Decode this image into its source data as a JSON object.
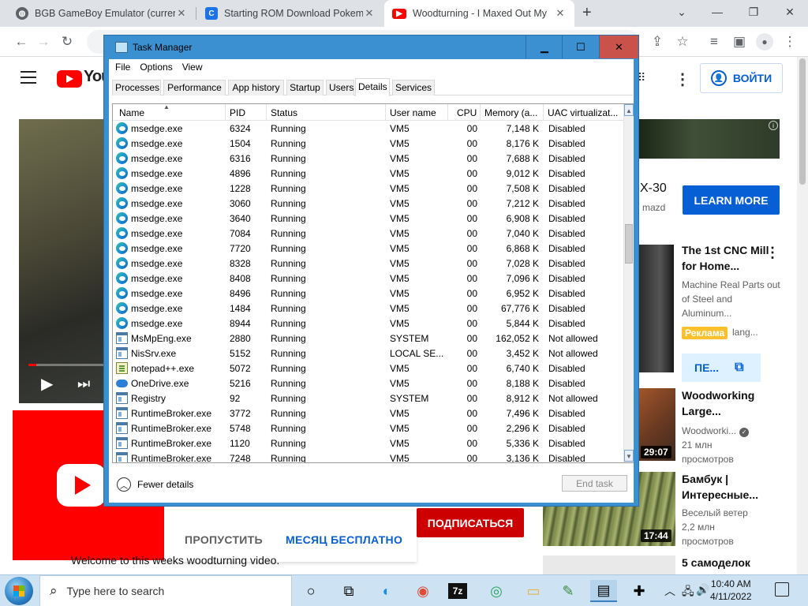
{
  "browser": {
    "tabs": [
      {
        "title": "BGB GameBoy Emulator (current",
        "favicon": "globe-icon",
        "active": false
      },
      {
        "title": "Starting ROM Download Pokemo",
        "favicon": "site-icon",
        "active": false
      },
      {
        "title": "Woodturning - I Maxed Out My",
        "favicon": "youtube-icon",
        "active": true
      }
    ],
    "tab_close": "✕",
    "new_tab": "+"
  },
  "youtube": {
    "logo_text": "YouT",
    "signin": "ВОЙТИ",
    "promo": {
      "skip": "ПРОПУСТИТЬ",
      "month_free": "МЕСЯЦ БЕСПЛАТНО",
      "subscribe": "ПОДПИСАТЬСЯ"
    },
    "welcome": "Welcome to this weeks woodturning video.",
    "ad": {
      "model": "X-30",
      "brand": "mazd",
      "learn_more": "LEARN MORE"
    },
    "recommendations": [
      {
        "title": "The 1st CNC Mill for Home...",
        "line1": "Machine Real Parts out of Steel and Aluminum...",
        "badge": "Реклама",
        "badge_extra": "lang...",
        "cta": "ПЕ..."
      },
      {
        "title": "Woodworking Large...",
        "channel": "Woodworki...",
        "views": "21 млн просмотров",
        "duration": "29:07"
      },
      {
        "title": "Бамбук | Интересные...",
        "channel": "Веселый ветер",
        "views": "2,2 млн просмотров",
        "duration": "17:44"
      },
      {
        "title": "5 самоделок"
      }
    ]
  },
  "task_manager": {
    "title": "Task Manager",
    "menu": [
      "File",
      "Options",
      "View"
    ],
    "tabs": [
      "Processes",
      "Performance",
      "App history",
      "Startup",
      "Users",
      "Details",
      "Services"
    ],
    "active_tab": "Details",
    "columns": [
      "Name",
      "PID",
      "Status",
      "User name",
      "CPU",
      "Memory (a...",
      "UAC virtualizat..."
    ],
    "rows": [
      {
        "icon": "edge",
        "name": "msedge.exe",
        "pid": "6324",
        "status": "Running",
        "user": "VM5",
        "cpu": "00",
        "mem": "7,148 K",
        "uac": "Disabled"
      },
      {
        "icon": "edge",
        "name": "msedge.exe",
        "pid": "1504",
        "status": "Running",
        "user": "VM5",
        "cpu": "00",
        "mem": "8,176 K",
        "uac": "Disabled"
      },
      {
        "icon": "edge",
        "name": "msedge.exe",
        "pid": "6316",
        "status": "Running",
        "user": "VM5",
        "cpu": "00",
        "mem": "7,688 K",
        "uac": "Disabled"
      },
      {
        "icon": "edge",
        "name": "msedge.exe",
        "pid": "4896",
        "status": "Running",
        "user": "VM5",
        "cpu": "00",
        "mem": "9,012 K",
        "uac": "Disabled"
      },
      {
        "icon": "edge",
        "name": "msedge.exe",
        "pid": "1228",
        "status": "Running",
        "user": "VM5",
        "cpu": "00",
        "mem": "7,508 K",
        "uac": "Disabled"
      },
      {
        "icon": "edge",
        "name": "msedge.exe",
        "pid": "3060",
        "status": "Running",
        "user": "VM5",
        "cpu": "00",
        "mem": "7,212 K",
        "uac": "Disabled"
      },
      {
        "icon": "edge",
        "name": "msedge.exe",
        "pid": "3640",
        "status": "Running",
        "user": "VM5",
        "cpu": "00",
        "mem": "6,908 K",
        "uac": "Disabled"
      },
      {
        "icon": "edge",
        "name": "msedge.exe",
        "pid": "7084",
        "status": "Running",
        "user": "VM5",
        "cpu": "00",
        "mem": "7,040 K",
        "uac": "Disabled"
      },
      {
        "icon": "edge",
        "name": "msedge.exe",
        "pid": "7720",
        "status": "Running",
        "user": "VM5",
        "cpu": "00",
        "mem": "6,868 K",
        "uac": "Disabled"
      },
      {
        "icon": "edge",
        "name": "msedge.exe",
        "pid": "8328",
        "status": "Running",
        "user": "VM5",
        "cpu": "00",
        "mem": "7,028 K",
        "uac": "Disabled"
      },
      {
        "icon": "edge",
        "name": "msedge.exe",
        "pid": "8408",
        "status": "Running",
        "user": "VM5",
        "cpu": "00",
        "mem": "7,096 K",
        "uac": "Disabled"
      },
      {
        "icon": "edge",
        "name": "msedge.exe",
        "pid": "8496",
        "status": "Running",
        "user": "VM5",
        "cpu": "00",
        "mem": "6,952 K",
        "uac": "Disabled"
      },
      {
        "icon": "edge",
        "name": "msedge.exe",
        "pid": "1484",
        "status": "Running",
        "user": "VM5",
        "cpu": "00",
        "mem": "67,776 K",
        "uac": "Disabled"
      },
      {
        "icon": "edge",
        "name": "msedge.exe",
        "pid": "8944",
        "status": "Running",
        "user": "VM5",
        "cpu": "00",
        "mem": "5,844 K",
        "uac": "Disabled"
      },
      {
        "icon": "win",
        "name": "MsMpEng.exe",
        "pid": "2880",
        "status": "Running",
        "user": "SYSTEM",
        "cpu": "00",
        "mem": "162,052 K",
        "uac": "Not allowed"
      },
      {
        "icon": "win",
        "name": "NisSrv.exe",
        "pid": "5152",
        "status": "Running",
        "user": "LOCAL SE...",
        "cpu": "00",
        "mem": "3,452 K",
        "uac": "Not allowed"
      },
      {
        "icon": "np",
        "name": "notepad++.exe",
        "pid": "5072",
        "status": "Running",
        "user": "VM5",
        "cpu": "00",
        "mem": "6,740 K",
        "uac": "Disabled"
      },
      {
        "icon": "cloud",
        "name": "OneDrive.exe",
        "pid": "5216",
        "status": "Running",
        "user": "VM5",
        "cpu": "00",
        "mem": "8,188 K",
        "uac": "Disabled"
      },
      {
        "icon": "win",
        "name": "Registry",
        "pid": "92",
        "status": "Running",
        "user": "SYSTEM",
        "cpu": "00",
        "mem": "8,912 K",
        "uac": "Not allowed"
      },
      {
        "icon": "win",
        "name": "RuntimeBroker.exe",
        "pid": "3772",
        "status": "Running",
        "user": "VM5",
        "cpu": "00",
        "mem": "7,496 K",
        "uac": "Disabled"
      },
      {
        "icon": "win",
        "name": "RuntimeBroker.exe",
        "pid": "5748",
        "status": "Running",
        "user": "VM5",
        "cpu": "00",
        "mem": "2,296 K",
        "uac": "Disabled"
      },
      {
        "icon": "win",
        "name": "RuntimeBroker.exe",
        "pid": "1120",
        "status": "Running",
        "user": "VM5",
        "cpu": "00",
        "mem": "5,336 K",
        "uac": "Disabled"
      },
      {
        "icon": "win",
        "name": "RuntimeBroker.exe",
        "pid": "7248",
        "status": "Running",
        "user": "VM5",
        "cpu": "00",
        "mem": "3,136 K",
        "uac": "Disabled"
      }
    ],
    "fewer_details": "Fewer details",
    "end_task": "End task"
  },
  "taskbar": {
    "search_placeholder": "Type here to search",
    "time": "10:40 AM",
    "date": "4/11/2022"
  },
  "colors": {
    "youtube_red": "#ff0000",
    "youtube_blue": "#065fd4",
    "tm_frame": "#3a90d0",
    "tm_close": "#c9524a",
    "taskbar": "#cde3f3"
  }
}
